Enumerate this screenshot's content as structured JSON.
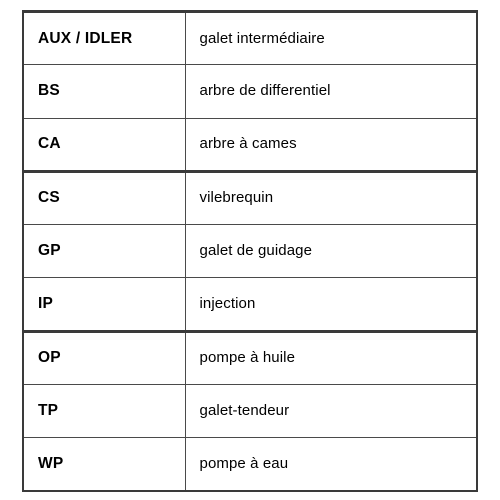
{
  "table": {
    "columns": [
      {
        "key": "abbreviation",
        "header": ""
      },
      {
        "key": "description",
        "header": ""
      }
    ],
    "header_visible": false,
    "language": "fr",
    "colors": {
      "outer_border": "#3a3a3a",
      "inner_border": "#4a4a4a",
      "group_border": "#3a3a3a",
      "text": "#000000",
      "background": "#ffffff"
    },
    "row_groups": [
      [
        0,
        1,
        2
      ],
      [
        3,
        4,
        5
      ],
      [
        6,
        7,
        8
      ]
    ],
    "rows": [
      {
        "abbreviation": "AUX / IDLER",
        "description": "galet intermédiaire"
      },
      {
        "abbreviation": "BS",
        "description": "arbre de differentiel"
      },
      {
        "abbreviation": "CA",
        "description": "arbre à cames"
      },
      {
        "abbreviation": "CS",
        "description": "vilebrequin"
      },
      {
        "abbreviation": "GP",
        "description": "galet de guidage"
      },
      {
        "abbreviation": "IP",
        "description": "injection"
      },
      {
        "abbreviation": "OP",
        "description": "pompe à huile"
      },
      {
        "abbreviation": "TP",
        "description": "galet-tendeur"
      },
      {
        "abbreviation": "WP",
        "description": "pompe à eau"
      }
    ]
  }
}
